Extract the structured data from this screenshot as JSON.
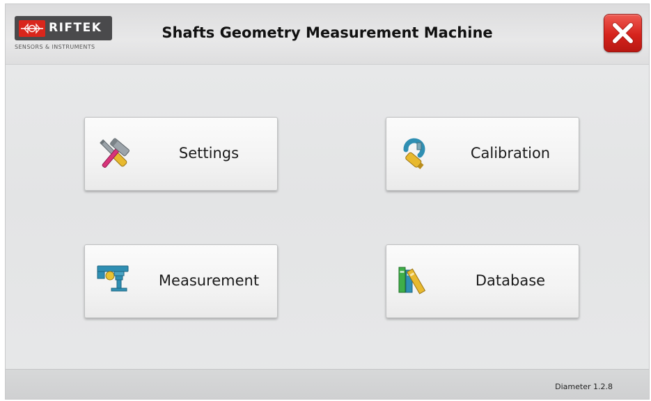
{
  "header": {
    "logo": {
      "brand": "RIFTEK",
      "tagline": "SENSORS & INSTRUMENTS"
    },
    "title": "Shafts Geometry Measurement Machine",
    "close_icon": "close-x-icon"
  },
  "tiles": [
    {
      "label": "Settings",
      "icon": "tools-icon"
    },
    {
      "label": "Calibration",
      "icon": "micrometer-icon"
    },
    {
      "label": "Measurement",
      "icon": "caliper-icon"
    },
    {
      "label": "Database",
      "icon": "books-icon"
    }
  ],
  "footer": {
    "version": "Diameter 1.2.8"
  },
  "colors": {
    "close_button": "#d6231c",
    "logo_plate": "#4a4a4c",
    "logo_red": "#d9261c"
  }
}
